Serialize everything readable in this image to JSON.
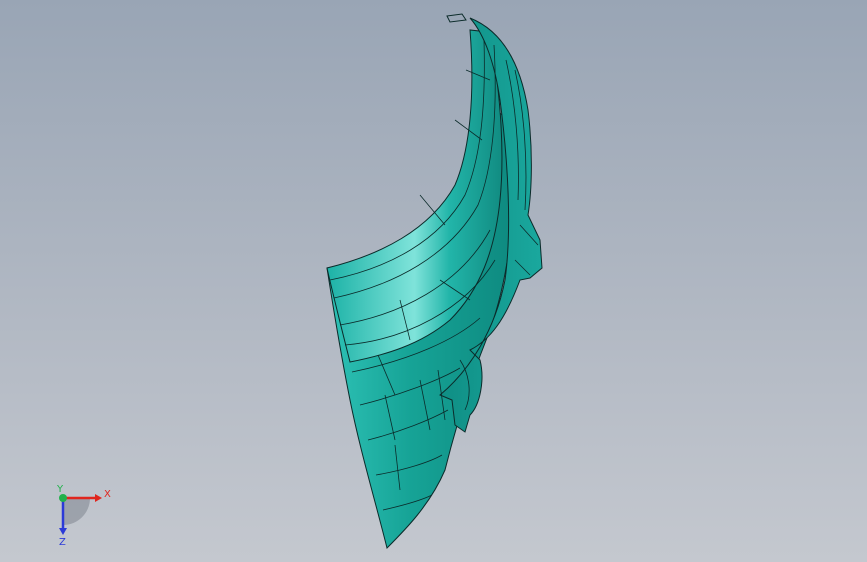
{
  "viewport": {
    "model_color": "#1aa89e",
    "edge_color": "#0b2b2a"
  },
  "triad": {
    "x_label": "X",
    "y_label": "Y",
    "z_label": "Z",
    "x_color": "#e0261e",
    "y_color": "#22b14c",
    "z_color": "#2b3ad8"
  }
}
